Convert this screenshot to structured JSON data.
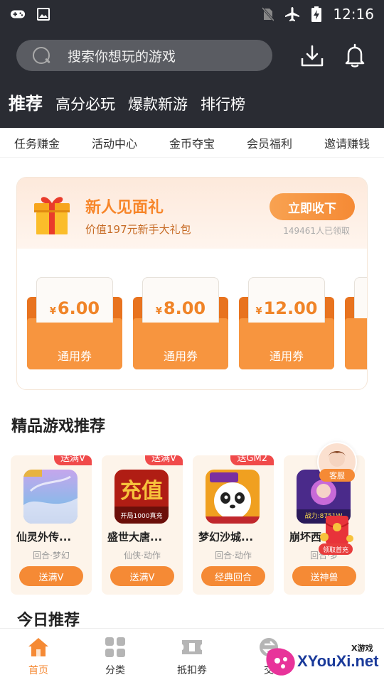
{
  "status_bar": {
    "time": "12:16",
    "left_icons": [
      "gamepad-icon",
      "image-icon"
    ],
    "right_icons": [
      "no-sim-icon",
      "airplane-icon",
      "battery-charging-icon"
    ]
  },
  "header": {
    "search_placeholder": "搜索你想玩的游戏",
    "tabs": [
      {
        "label": "推荐",
        "active": true
      },
      {
        "label": "高分必玩",
        "active": false
      },
      {
        "label": "爆款新游",
        "active": false
      },
      {
        "label": "排行榜",
        "active": false
      }
    ]
  },
  "quick_links": [
    "任务赚金",
    "活动中心",
    "金币夺宝",
    "会员福利",
    "邀请赚钱"
  ],
  "gift": {
    "title": "新人见面礼",
    "subtitle": "价值197元新手大礼包",
    "claim_button": "立即收下",
    "claimed_count": "149461人已领取",
    "currency_symbol": "¥",
    "coupons": [
      {
        "amount": "6.00",
        "label": "通用券"
      },
      {
        "amount": "8.00",
        "label": "通用券"
      },
      {
        "amount": "12.00",
        "label": "通用券"
      }
    ]
  },
  "featured": {
    "title": "精品游戏推荐",
    "games": [
      {
        "tag": "送满V",
        "name": "仙灵外传...",
        "genre": "回合·梦幻",
        "button": "送满V"
      },
      {
        "tag": "送满V",
        "name": "盛世大唐...",
        "genre": "仙侠·动作",
        "button": "送满V"
      },
      {
        "tag": "送GM2",
        "name": "梦幻沙城...",
        "genre": "回合·动作",
        "button": "经典回合"
      },
      {
        "tag": "",
        "name": "崩坏西...",
        "genre": "回合·梦",
        "button": "送神兽"
      }
    ],
    "icon_captions": [
      "开局1000真充",
      "战力:8751W"
    ]
  },
  "floating": {
    "customer_service": "客服",
    "red_packet": "领取首充"
  },
  "today": {
    "title": "今日推荐"
  },
  "bottom_nav": [
    {
      "label": "首页",
      "icon": "home-icon",
      "active": true
    },
    {
      "label": "分类",
      "icon": "grid-icon",
      "active": false
    },
    {
      "label": "抵扣券",
      "icon": "coupon-icon",
      "active": false
    },
    {
      "label": "交",
      "icon": "trade-icon",
      "active": false
    }
  ],
  "watermark": {
    "text": "XYouXi.net",
    "small": "X游戏"
  },
  "colors": {
    "accent": "#f58a35",
    "header_bg": "#2a2c33",
    "tag_red": "#f04a4a"
  }
}
